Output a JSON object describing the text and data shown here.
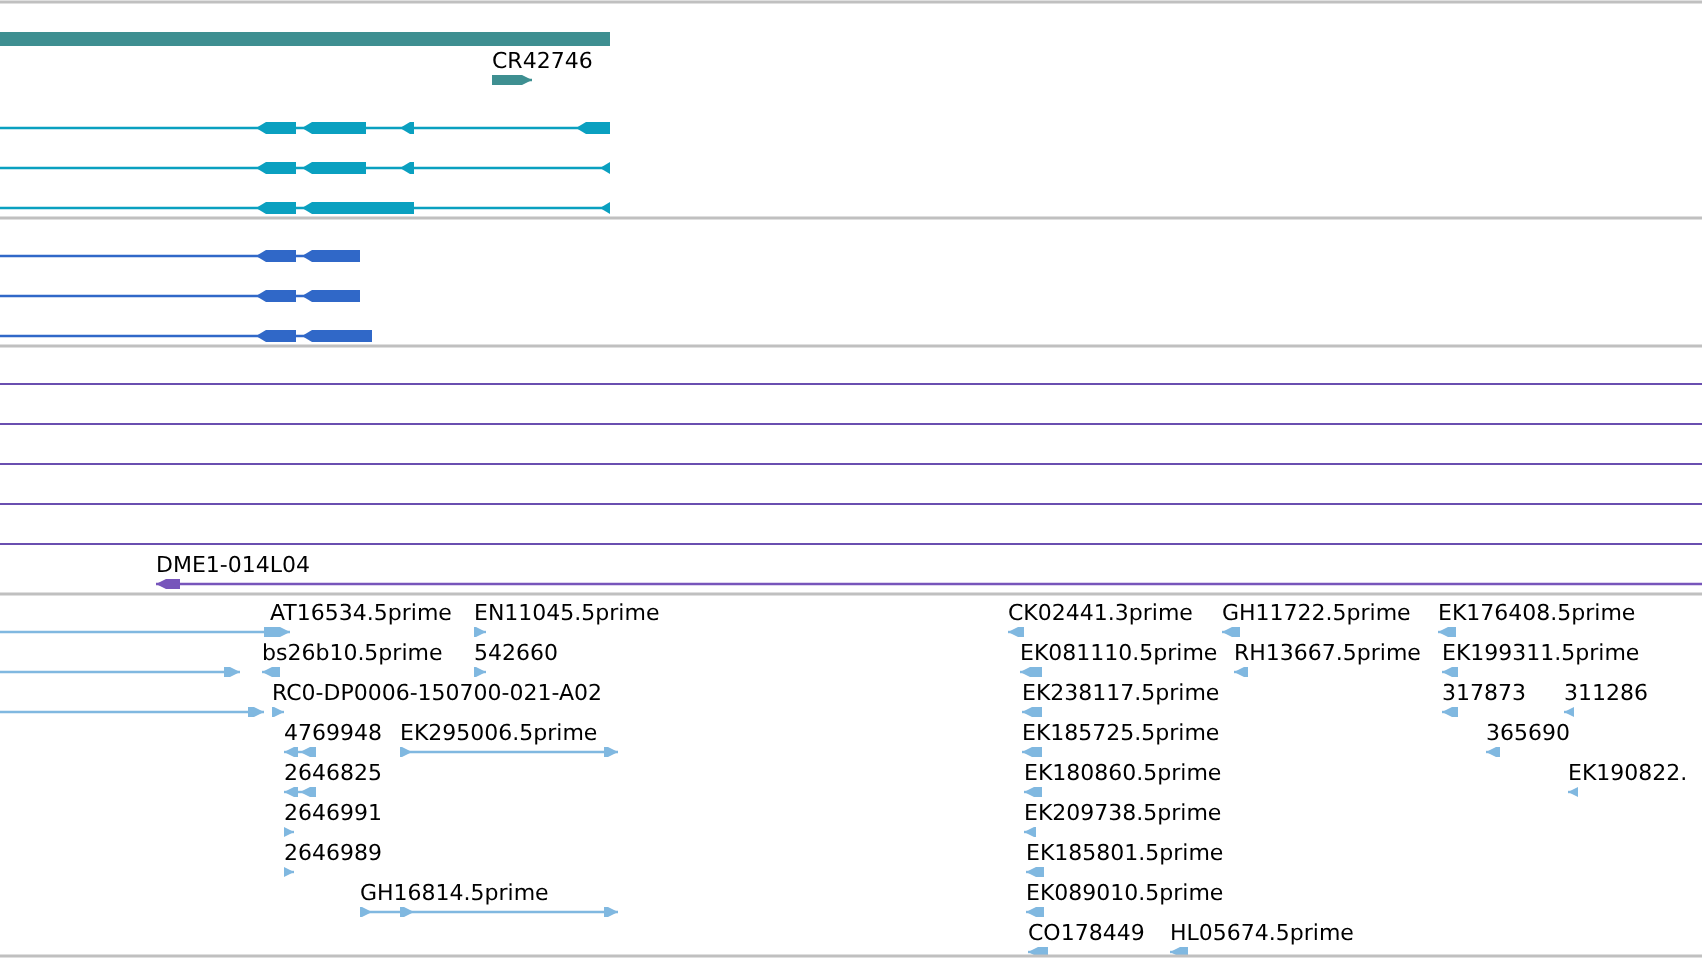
{
  "tracks": [
    {
      "kind": "region",
      "features": [
        {
          "label": "CR42746",
          "reverse": false
        }
      ]
    },
    {
      "kind": "transcripts",
      "features": [
        {
          "reverse": true
        },
        {
          "reverse": true
        },
        {
          "reverse": true
        }
      ]
    },
    {
      "kind": "models",
      "features": [
        {
          "reverse": true
        },
        {
          "reverse": true
        },
        {
          "reverse": true
        }
      ]
    },
    {
      "kind": "clones",
      "features": [
        {
          "label": "DME1-014L04",
          "reverse": true
        }
      ]
    },
    {
      "kind": "ests",
      "rows": [
        {
          "features": [
            {
              "label": "AT16534.5prime",
              "reverse": false
            },
            {
              "label": "EN11045.5prime",
              "reverse": false
            },
            {
              "label": "CK02441.3prime",
              "reverse": true
            },
            {
              "label": "GH11722.5prime",
              "reverse": true
            },
            {
              "label": "EK176408.5prime",
              "reverse": true
            }
          ]
        },
        {
          "features": [
            {
              "reverse": false
            },
            {
              "label": "bs26b10.5prime",
              "reverse": true
            },
            {
              "label": "542660",
              "reverse": false
            },
            {
              "label": "EK081110.5prime",
              "reverse": true
            },
            {
              "label": "RH13667.5prime",
              "reverse": true
            },
            {
              "label": "EK199311.5prime",
              "reverse": true
            }
          ]
        },
        {
          "features": [
            {
              "reverse": false
            },
            {
              "label": "RC0-DP0006-150700-021-A02",
              "reverse": false
            },
            {
              "label": "EK238117.5prime",
              "reverse": true
            },
            {
              "label": "317873",
              "reverse": true
            },
            {
              "label": "311286",
              "reverse": true
            }
          ]
        },
        {
          "features": [
            {
              "label": "4769948",
              "reverse": true
            },
            {
              "label": "EK295006.5prime",
              "reverse": false
            },
            {
              "label": "EK185725.5prime",
              "reverse": true
            },
            {
              "label": "365690",
              "reverse": true
            }
          ]
        },
        {
          "features": [
            {
              "label": "2646825",
              "reverse": true
            },
            {
              "label": "EK180860.5prime",
              "reverse": true
            },
            {
              "label": "EK190822.",
              "reverse": true
            }
          ]
        },
        {
          "features": [
            {
              "label": "2646991",
              "reverse": false
            },
            {
              "label": "EK209738.5prime",
              "reverse": true
            }
          ]
        },
        {
          "features": [
            {
              "label": "2646989",
              "reverse": false
            },
            {
              "label": "EK185801.5prime",
              "reverse": true
            }
          ]
        },
        {
          "features": [
            {
              "label": "GH16814.5prime",
              "reverse": false
            },
            {
              "label": "EK089010.5prime",
              "reverse": true
            }
          ]
        },
        {
          "features": [
            {
              "label": "CO178449",
              "reverse": true
            },
            {
              "label": "HL05674.5prime",
              "reverse": true
            }
          ]
        }
      ]
    }
  ]
}
